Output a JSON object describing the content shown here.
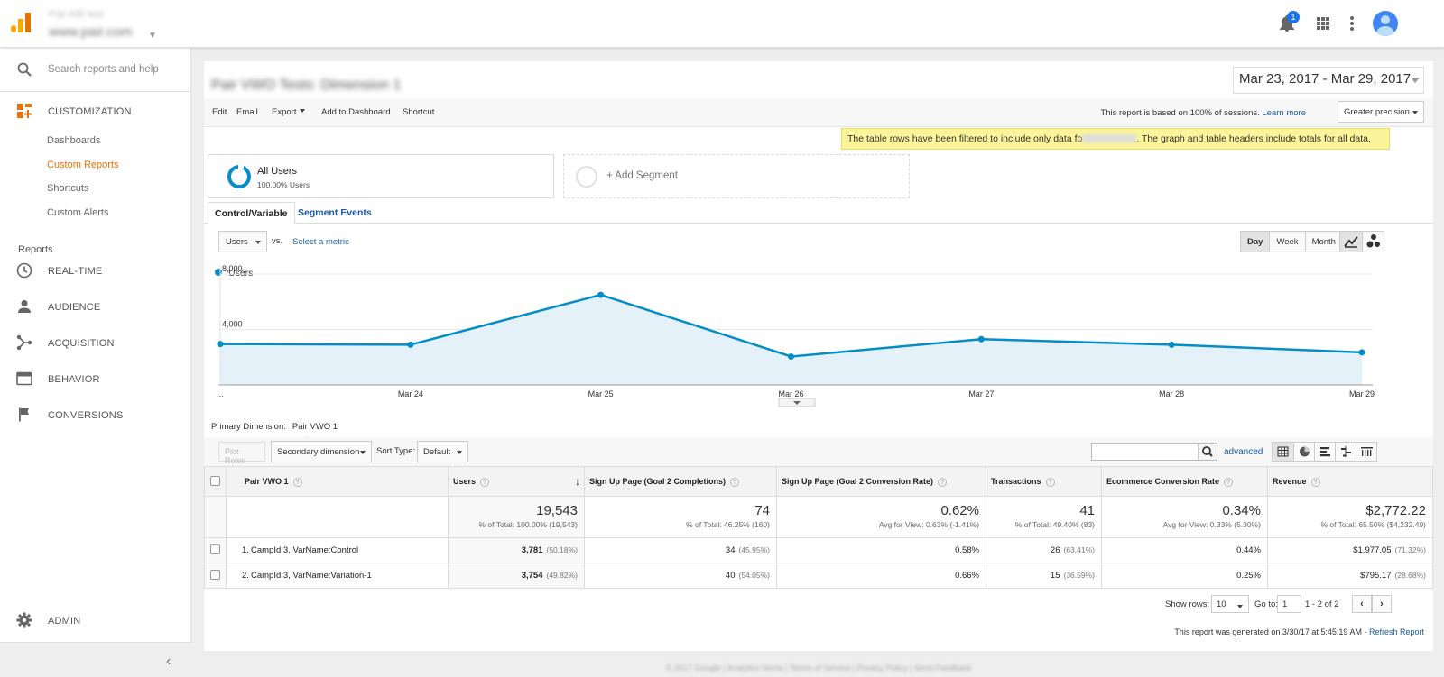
{
  "header": {
    "account_line1": "Pair A/B test",
    "account_line2": "www.pair.com",
    "notification_count": "1"
  },
  "sidebar": {
    "search_placeholder": "Search reports and help",
    "customization_label": "CUSTOMIZATION",
    "custom_items": [
      {
        "label": "Dashboards",
        "active": false
      },
      {
        "label": "Custom Reports",
        "active": true
      },
      {
        "label": "Shortcuts",
        "active": false
      },
      {
        "label": "Custom Alerts",
        "active": false
      }
    ],
    "reports_label": "Reports",
    "main_items": [
      {
        "label": "REAL-TIME",
        "icon": "clock-icon"
      },
      {
        "label": "AUDIENCE",
        "icon": "person-icon"
      },
      {
        "label": "ACQUISITION",
        "icon": "acquisition-icon"
      },
      {
        "label": "BEHAVIOR",
        "icon": "behavior-icon"
      },
      {
        "label": "CONVERSIONS",
        "icon": "flag-icon"
      }
    ],
    "admin_label": "ADMIN",
    "collapse_glyph": "‹"
  },
  "report": {
    "title": "Pair VWO Tests: Dimension 1",
    "date_range": "Mar 23, 2017 - Mar 29, 2017",
    "actions": {
      "edit": "Edit",
      "email": "Email",
      "export": "Export",
      "add_to_dashboard": "Add to Dashboard",
      "shortcut": "Shortcut"
    },
    "basis_text": "This report is based on 100% of sessions.",
    "learn_more": "Learn more",
    "precision": "Greater precision",
    "filter_note_a": "The table rows have been filtered to include only data fo",
    "filter_note_b": ". The graph and table headers include totals for all data."
  },
  "segments": {
    "all_users_title": "All Users",
    "all_users_sub": "100.00% Users",
    "add_segment": "+ Add Segment"
  },
  "tabs": {
    "control": "Control/Variable",
    "events": "Segment Events"
  },
  "chart_controls": {
    "metric": "Users",
    "vs": "vs.",
    "select_metric": "Select a metric",
    "day": "Day",
    "week": "Week",
    "month": "Month"
  },
  "chart_data": {
    "type": "area",
    "legend": "Users",
    "color": "#058dc7",
    "fill": "#e5f1f8",
    "x": [
      "...",
      "Mar 24",
      "Mar 25",
      "Mar 26",
      "Mar 27",
      "Mar 28",
      "Mar 29"
    ],
    "values": [
      2950,
      2900,
      6500,
      2050,
      3300,
      2900,
      2350
    ],
    "y_ticks": [
      {
        "value": 4000,
        "label": "4,000"
      },
      {
        "value": 8000,
        "label": "8,000"
      }
    ],
    "ylim": [
      0,
      8000
    ],
    "grid": true
  },
  "table": {
    "primary_dimension_label": "Primary Dimension:",
    "primary_dimension": "Pair VWO 1",
    "plot_rows": "Plot Rows",
    "secondary_dimension": "Secondary dimension",
    "sort_type_label": "Sort Type:",
    "sort_type": "Default",
    "advanced": "advanced",
    "headers": {
      "dim": "Pair VWO 1",
      "users": "Users",
      "goal2_completions": "Sign Up Page (Goal 2 Completions)",
      "goal2_rate": "Sign Up Page (Goal 2 Conversion Rate)",
      "transactions": "Transactions",
      "ecomm_rate": "Ecommerce Conversion Rate",
      "revenue": "Revenue"
    },
    "totals": {
      "users": "19,543",
      "users_pct": "% of Total: 100.00% (19,543)",
      "goal2_completions": "74",
      "goal2_completions_pct": "% of Total: 46.25% (160)",
      "goal2_rate": "0.62%",
      "goal2_rate_pct": "Avg for View: 0.63% (-1.41%)",
      "transactions": "41",
      "transactions_pct": "% of Total: 49.40% (83)",
      "ecomm_rate": "0.34%",
      "ecomm_rate_pct": "Avg for View: 0.33% (5.30%)",
      "revenue": "$2,772.22",
      "revenue_pct": "% of Total: 65.50% ($4,232.49)"
    },
    "rows": [
      {
        "idx": "1.",
        "dim": "CampId:3, VarName:Control",
        "users": "3,781",
        "users_share": "(50.18%)",
        "goal2_completions": "34",
        "goal2_completions_share": "(45.95%)",
        "goal2_rate": "0.58%",
        "transactions": "26",
        "transactions_share": "(63.41%)",
        "ecomm_rate": "0.44%",
        "revenue": "$1,977.05",
        "revenue_share": "(71.32%)"
      },
      {
        "idx": "2.",
        "dim": "CampId:3, VarName:Variation-1",
        "users": "3,754",
        "users_share": "(49.82%)",
        "goal2_completions": "40",
        "goal2_completions_share": "(54.05%)",
        "goal2_rate": "0.66%",
        "transactions": "15",
        "transactions_share": "(36.59%)",
        "ecomm_rate": "0.25%",
        "revenue": "$795.17",
        "revenue_share": "(28.68%)"
      }
    ],
    "show_rows_label": "Show rows:",
    "show_rows": "10",
    "goto_label": "Go to:",
    "goto_value": "1",
    "range_text": "1 - 2 of 2",
    "generated_text": "This report was generated on 3/30/17 at 5:45:19 AM -",
    "refresh_report": "Refresh Report"
  },
  "footer": {
    "text": "© 2017 Google | Analytics Home | Terms of Service | Privacy Policy | Send Feedback"
  }
}
